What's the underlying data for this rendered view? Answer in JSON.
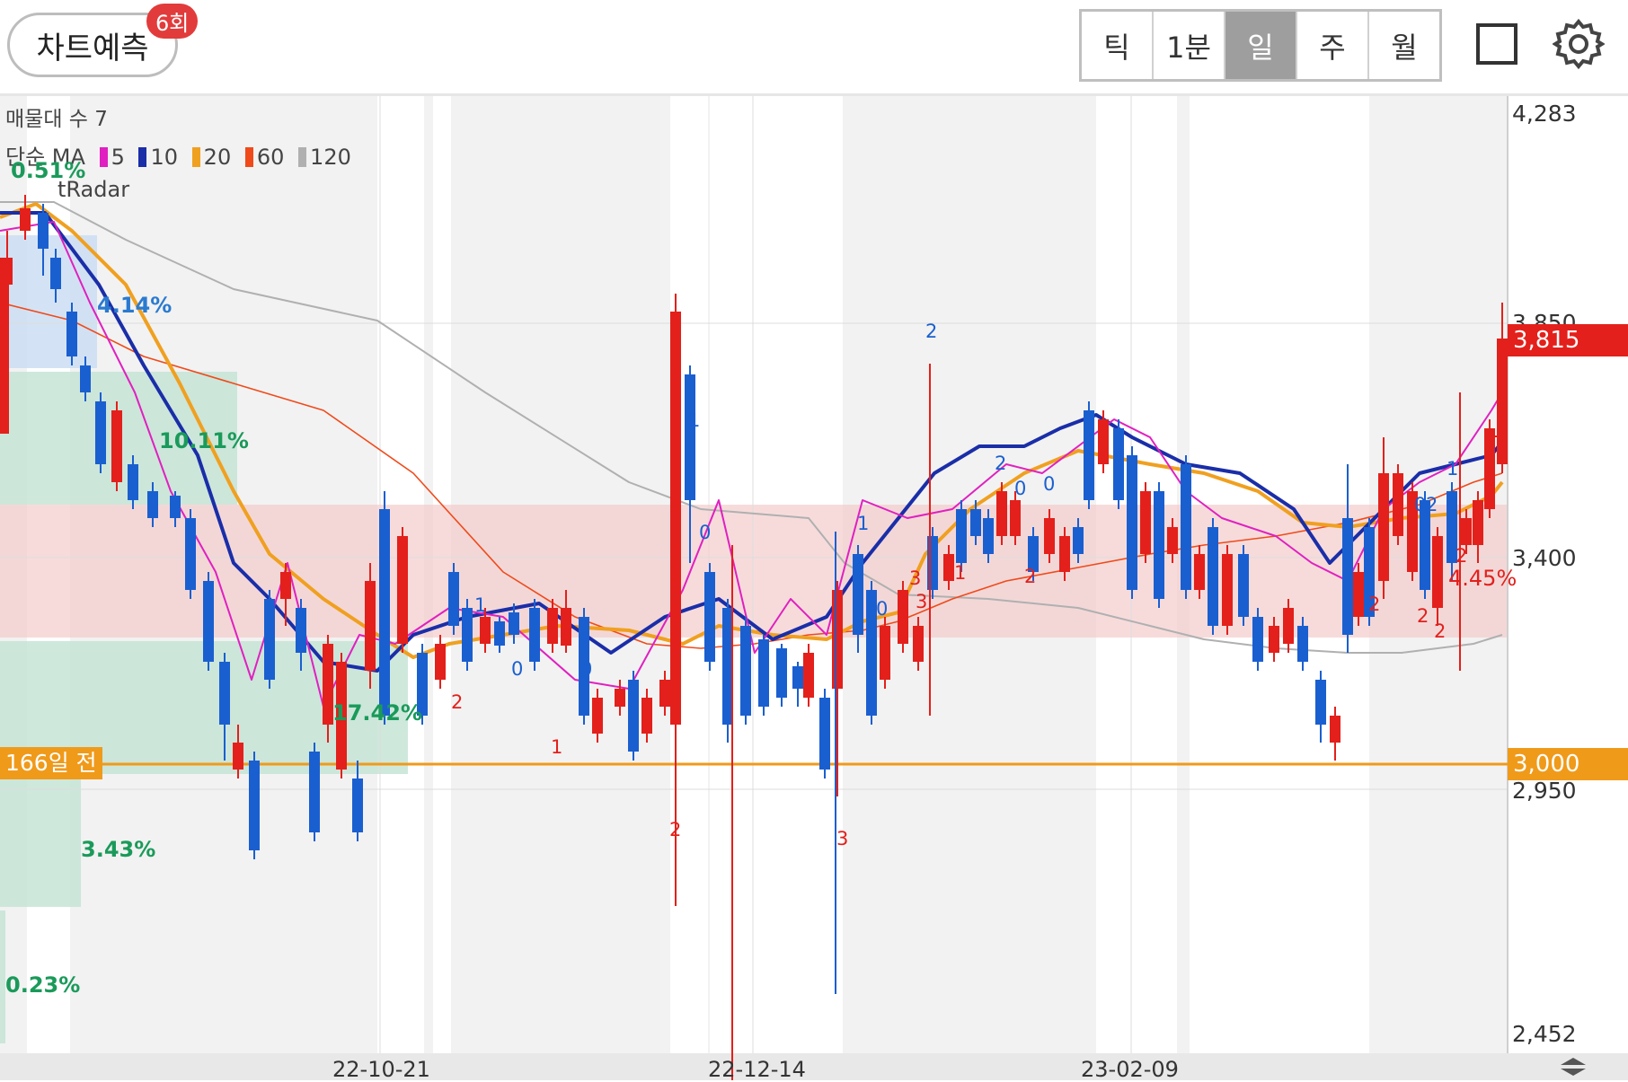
{
  "header": {
    "predict_label": "차트예측",
    "predict_count": "6회",
    "periods": [
      "틱",
      "1분",
      "일",
      "주",
      "월"
    ],
    "active_period": "일"
  },
  "legend": {
    "volume_profile": "매물대 수 7",
    "ma_prefix": "단순 MA",
    "ma_items": [
      {
        "label": "5",
        "color": "#e020c0"
      },
      {
        "label": "10",
        "color": "#1a2ea8"
      },
      {
        "label": "20",
        "color": "#f0a020"
      },
      {
        "label": "60",
        "color": "#f04a1a"
      },
      {
        "label": "120",
        "color": "#b0b0b0"
      }
    ],
    "indicator": "tRadar"
  },
  "price_axis": {
    "labels": [
      "4,283",
      "3,850",
      "3,400",
      "2,950",
      "2,452"
    ],
    "current_price": "3,815",
    "reference_price": "3,000",
    "reference_label": "166일 전"
  },
  "date_axis": [
    "22-10-21",
    "22-12-14",
    "23-02-09"
  ],
  "percent_labels": [
    "0.51%",
    "4.14%",
    "10.11%",
    "17.42%",
    "3.43%",
    "0.23%",
    "4.45%"
  ],
  "signal_labels": [
    "1",
    "0",
    "0",
    "1",
    "2",
    "1",
    "0",
    "2",
    "3",
    "1",
    "0",
    "2",
    "3",
    "2",
    "0",
    "0",
    "2",
    "1",
    "0",
    "2",
    "3",
    "2",
    "1",
    "2",
    "3",
    "2",
    "2"
  ],
  "colors": {
    "up": "#e3201b",
    "down": "#1a5fd0",
    "accent": "#f09a1a",
    "current": "#e3201b"
  },
  "icons": [
    "square-icon",
    "gear-icon",
    "scroll-handle-icon"
  ]
}
